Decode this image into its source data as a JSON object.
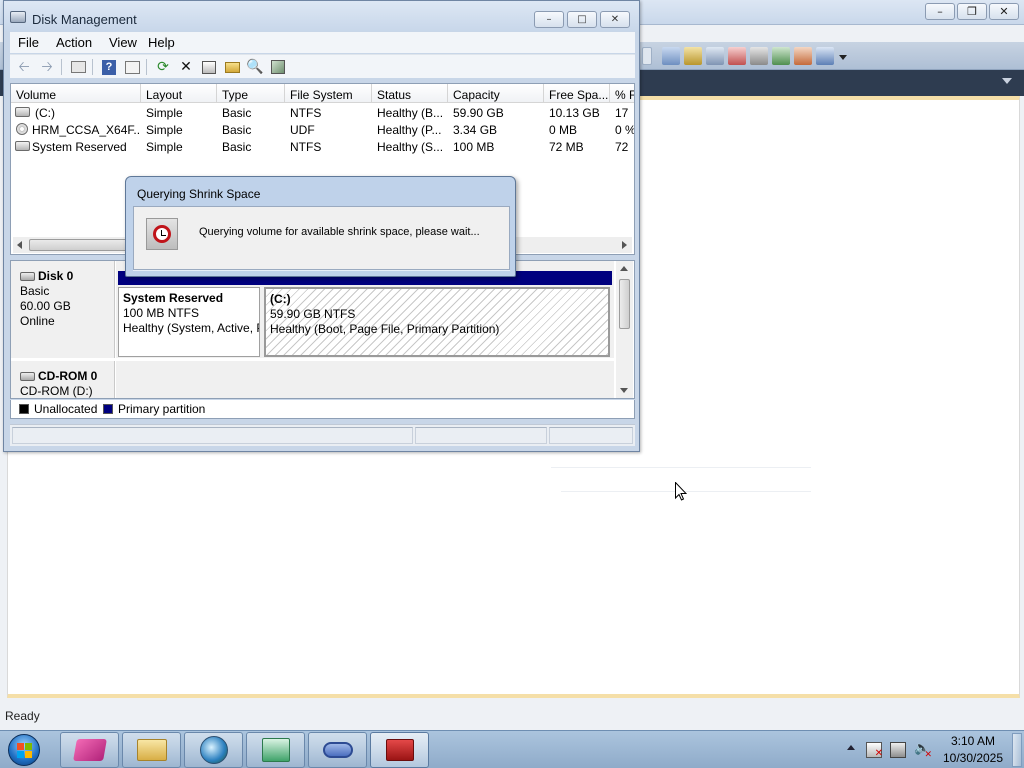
{
  "background_app": {
    "status_text": "Ready"
  },
  "disk_management": {
    "window_title": "Disk Management",
    "menu": [
      "File",
      "Action",
      "View",
      "Help"
    ],
    "toolbar_icons": [
      "back-arrow-icon",
      "forward-arrow-icon",
      "console-tree-icon",
      "help-icon",
      "properties-list-icon",
      "refresh-icon",
      "delete-icon",
      "properties-icon",
      "open-icon",
      "rescan-icon",
      "settings-icon"
    ],
    "columns": [
      "Volume",
      "Layout",
      "Type",
      "File System",
      "Status",
      "Capacity",
      "Free Spa...",
      "% F"
    ],
    "volumes": [
      {
        "volume": "(C:)",
        "layout": "Simple",
        "type": "Basic",
        "file_system": "NTFS",
        "status": "Healthy (B...",
        "capacity": "59.90 GB",
        "free_space": "10.13 GB",
        "pct_free": "17",
        "icon": "drive-icon"
      },
      {
        "volume": "HRM_CCSA_X64F...",
        "layout": "Simple",
        "type": "Basic",
        "file_system": "UDF",
        "status": "Healthy (P...",
        "capacity": "3.34 GB",
        "free_space": "0 MB",
        "pct_free": "0 %",
        "icon": "cd-drive-icon"
      },
      {
        "volume": "System Reserved",
        "layout": "Simple",
        "type": "Basic",
        "file_system": "NTFS",
        "status": "Healthy (S...",
        "capacity": "100 MB",
        "free_space": "72 MB",
        "pct_free": "72",
        "icon": "drive-icon"
      }
    ],
    "disks": [
      {
        "name": "Disk 0",
        "kind": "Basic",
        "size": "60.00 GB",
        "state": "Online",
        "partitions": [
          {
            "name": "System Reserved",
            "size_fs": "100 MB NTFS",
            "status": "Healthy (System, Active, Primary Partition)"
          },
          {
            "name": "(C:)",
            "size_fs": "59.90 GB NTFS",
            "status": "Healthy (Boot, Page File, Primary Partition)"
          }
        ]
      },
      {
        "name": "CD-ROM 0",
        "kind": "CD-ROM (D:)"
      }
    ],
    "legend": [
      {
        "label": "Unallocated",
        "color": "#000000"
      },
      {
        "label": "Primary partition",
        "color": "#00007f"
      }
    ]
  },
  "dialog": {
    "title": "Querying Shrink Space",
    "message": "Querying volume for available shrink space, please wait...",
    "icon": "clock-icon"
  },
  "taskbar": {
    "start_icon": "windows-start-icon",
    "pinned": [
      "ribbon-app-icon",
      "file-explorer-icon",
      "browser-icon",
      "download-app-icon",
      "infinity-app-icon",
      "toolbox-icon"
    ],
    "time": "3:10 AM",
    "date": "10/30/2025"
  },
  "colors": {
    "primary_partition": "#00007f",
    "unallocated": "#000000",
    "accent_stripe": "#f5dfa8"
  }
}
